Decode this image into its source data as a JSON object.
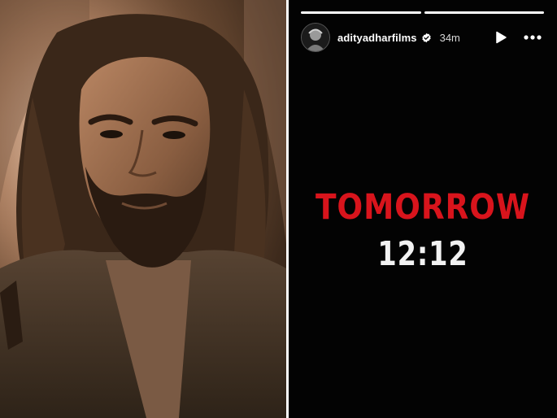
{
  "story": {
    "username": "adityadharfilms",
    "time_ago": "34m",
    "progress": [
      1.0,
      1.0
    ],
    "headline": "TOMORROW",
    "subline": "12:12"
  },
  "icons": {
    "verified": "verified-badge-icon",
    "play": "play-icon",
    "more": "more-options-icon"
  },
  "colors": {
    "story_background": "#030303",
    "headline_red": "#d8141c",
    "subline_white": "#f2f2f2"
  }
}
